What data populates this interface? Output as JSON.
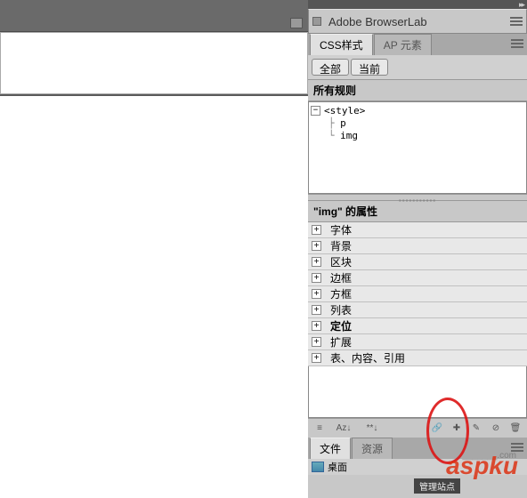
{
  "browserlab_title": "Adobe BrowserLab",
  "css_panel": {
    "tabs": {
      "css_styles": "CSS样式",
      "ap_elements": "AP 元素"
    },
    "filter": {
      "all": "全部",
      "current": "当前"
    },
    "all_rules_header": "所有规则",
    "rules_tree": {
      "root": "<style>",
      "child1": "p",
      "child2": "img"
    },
    "properties_header": "\"img\" 的属性",
    "property_categories": [
      "字体",
      "背景",
      "区块",
      "边框",
      "方框",
      "列表",
      "定位",
      "扩展",
      "表、内容、引用"
    ],
    "toolbar": {
      "sort": "Az↓",
      "rule": "**↓"
    }
  },
  "files_panel": {
    "tabs": {
      "files": "文件",
      "assets": "资源"
    },
    "desktop": "桌面",
    "site_mgmt": "管理站点"
  },
  "watermark": "aspku",
  "watermark_sub": "_______.com"
}
